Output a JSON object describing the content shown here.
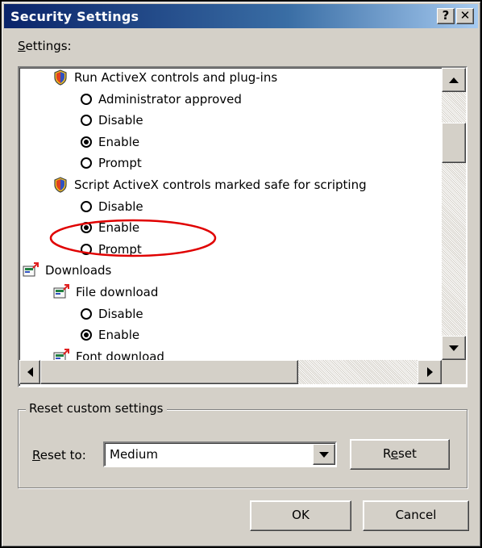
{
  "window": {
    "title": "Security Settings",
    "help_label": "?",
    "close_label": "✕"
  },
  "settings": {
    "label": "Settings:",
    "tree": [
      {
        "kind": "shield",
        "text": "Run ActiveX controls and plug-ins",
        "indent": 1
      },
      {
        "kind": "radio",
        "text": "Administrator approved",
        "checked": false,
        "indent": 2
      },
      {
        "kind": "radio",
        "text": "Disable",
        "checked": false,
        "indent": 2
      },
      {
        "kind": "radio",
        "text": "Enable",
        "checked": true,
        "indent": 2
      },
      {
        "kind": "radio",
        "text": "Prompt",
        "checked": false,
        "indent": 2
      },
      {
        "kind": "shield",
        "text": "Script ActiveX controls marked safe for scripting",
        "indent": 1
      },
      {
        "kind": "radio",
        "text": "Disable",
        "checked": false,
        "indent": 2
      },
      {
        "kind": "radio",
        "text": "Enable",
        "checked": true,
        "indent": 2
      },
      {
        "kind": "radio",
        "text": "Prompt",
        "checked": false,
        "indent": 2
      },
      {
        "kind": "download",
        "text": "Downloads",
        "indent": 0
      },
      {
        "kind": "download",
        "text": "File download",
        "indent": 1
      },
      {
        "kind": "radio",
        "text": "Disable",
        "checked": false,
        "indent": 2
      },
      {
        "kind": "radio",
        "text": "Enable",
        "checked": true,
        "indent": 2
      },
      {
        "kind": "download",
        "text": "Font download",
        "indent": 1
      }
    ]
  },
  "reset_group": {
    "legend": "Reset custom settings",
    "reset_to_label": "Reset to:",
    "selected_value": "Medium",
    "reset_button": "Reset"
  },
  "footer": {
    "ok_label": "OK",
    "cancel_label": "Cancel"
  },
  "colors": {
    "highlight_ellipse": "#e00000",
    "titlebar_start": "#0a246a"
  }
}
